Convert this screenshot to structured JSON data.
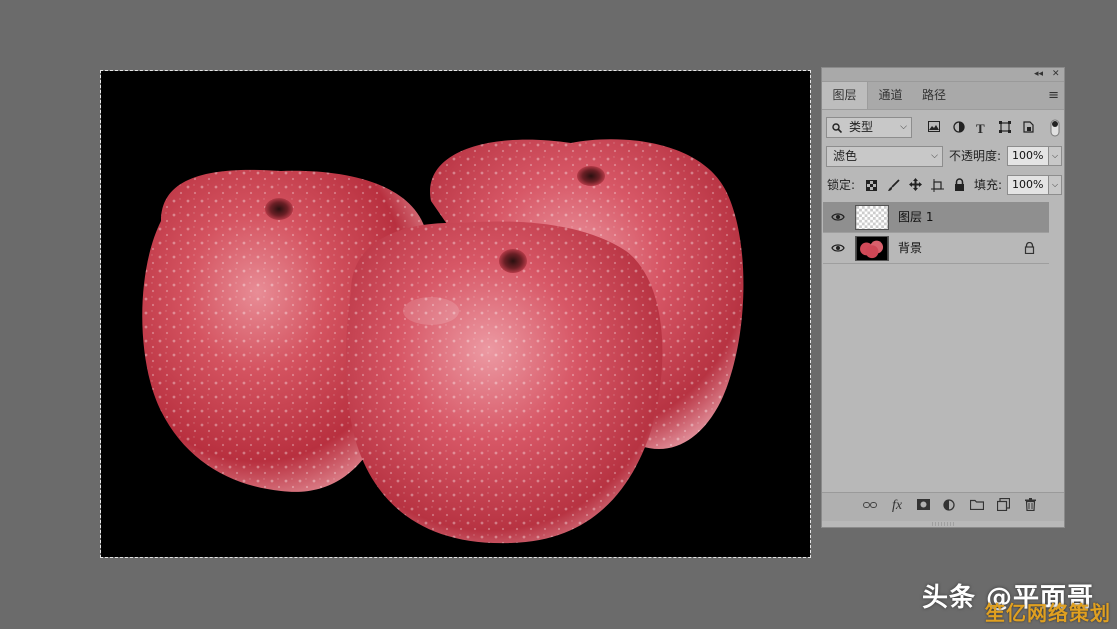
{
  "panel": {
    "tabs": [
      {
        "label": "图层",
        "active": true
      },
      {
        "label": "通道",
        "active": false
      },
      {
        "label": "路径",
        "active": false
      }
    ],
    "topbar": {
      "collapse": "◂◂",
      "close": "✕"
    },
    "menu_icon": "≡",
    "filter": {
      "value": "类型",
      "icon": "search-icon"
    },
    "filter_icons": [
      "image-filter-icon",
      "adjustment-filter-icon",
      "type-filter-icon",
      "shape-filter-icon",
      "smart-object-filter-icon"
    ],
    "blend_mode": "滤色",
    "opacity_label": "不透明度:",
    "opacity_value": "100%",
    "lock_label": "锁定:",
    "lock_icons": [
      "lock-transparent-icon",
      "lock-paint-icon",
      "lock-position-icon",
      "lock-artboard-icon",
      "lock-all-icon"
    ],
    "fill_label": "填充:",
    "fill_value": "100%",
    "layers": [
      {
        "name": "图层 1",
        "selected": true,
        "visible": true,
        "locked": false,
        "thumb": "transparent"
      },
      {
        "name": "背景",
        "selected": false,
        "visible": true,
        "locked": true,
        "thumb": "apples"
      }
    ],
    "bottom_icons": [
      "link-layers-icon",
      "fx-icon",
      "layer-mask-icon",
      "adjustment-layer-icon",
      "group-folder-icon",
      "new-layer-icon",
      "trash-icon"
    ],
    "fx_label": "fx"
  },
  "watermark": {
    "line1": "头条 @平面哥",
    "line2": "笙亿网络策划"
  },
  "colors": {
    "workspace": "#6b6b6b",
    "canvas": "#000000",
    "panel": "#b8b8b8",
    "selected_layer": "#8f8f8f",
    "apple_red": "#c9414e"
  }
}
